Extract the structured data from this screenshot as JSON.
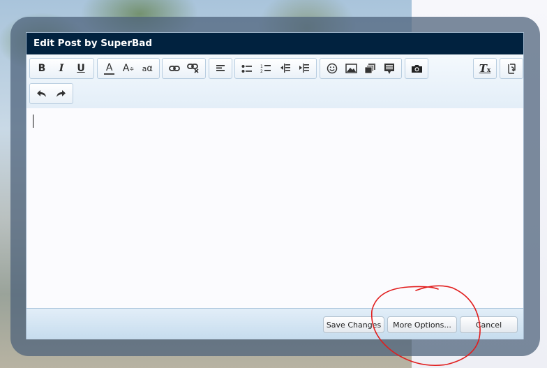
{
  "dialog": {
    "title": "Edit Post by SuperBad"
  },
  "toolbar": {
    "bold_label": "B",
    "italic_label": "I",
    "underline_label": "U",
    "font_color_label": "A",
    "font_size_label": "A",
    "font_size_mark": "≑",
    "font_family_label": "a",
    "font_family_sub": "α",
    "remove_format_label": "T",
    "remove_format_sub": "x"
  },
  "editor": {
    "content": ""
  },
  "footer": {
    "save_label": "Save Changes",
    "more_options_label": "More Options...",
    "cancel_label": "Cancel"
  },
  "colors": {
    "title_bar": "#01223f",
    "annotation": "#e11d1d"
  }
}
